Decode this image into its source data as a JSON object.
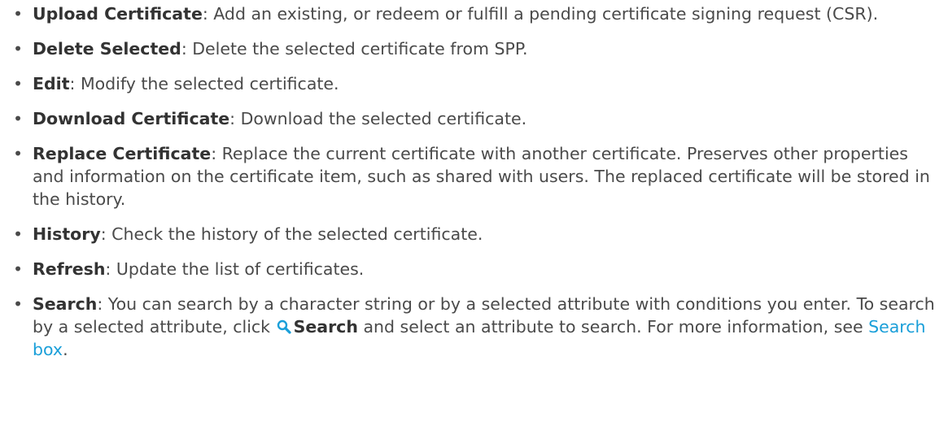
{
  "items": [
    {
      "term": "Upload Certificate",
      "text": ": Add an existing, or redeem or fulfill a pending certificate signing request (CSR)."
    },
    {
      "term": "Delete Selected",
      "text": ": Delete the selected certificate from SPP."
    },
    {
      "term": "Edit",
      "text": ": Modify the selected certificate."
    },
    {
      "term": "Download Certificate",
      "text": ": Download the selected certificate."
    },
    {
      "term": "Replace Certificate",
      "text": ": Replace the current certificate with another certificate. Preserves other properties and information on the certificate item, such as shared with users. The replaced certificate will be stored in the history."
    },
    {
      "term": "History",
      "text": ": Check the history of the selected certificate."
    },
    {
      "term": "Refresh",
      "text": ": Update the list of certificates."
    },
    {
      "term": "Search",
      "text_before_icon": ": You can search by a character string or by a selected attribute with conditions you enter. To search by a selected attribute, click ",
      "icon": "search-icon",
      "inline_term": "Search",
      "text_after_term": " and select an attribute to search. For more information, see ",
      "link_text": "Search box",
      "text_end": "."
    }
  ],
  "bullet_char": "•",
  "colors": {
    "text": "#4a4a4a",
    "term": "#333333",
    "link": "#1a9fd9",
    "icon": "#1a9fd9"
  }
}
